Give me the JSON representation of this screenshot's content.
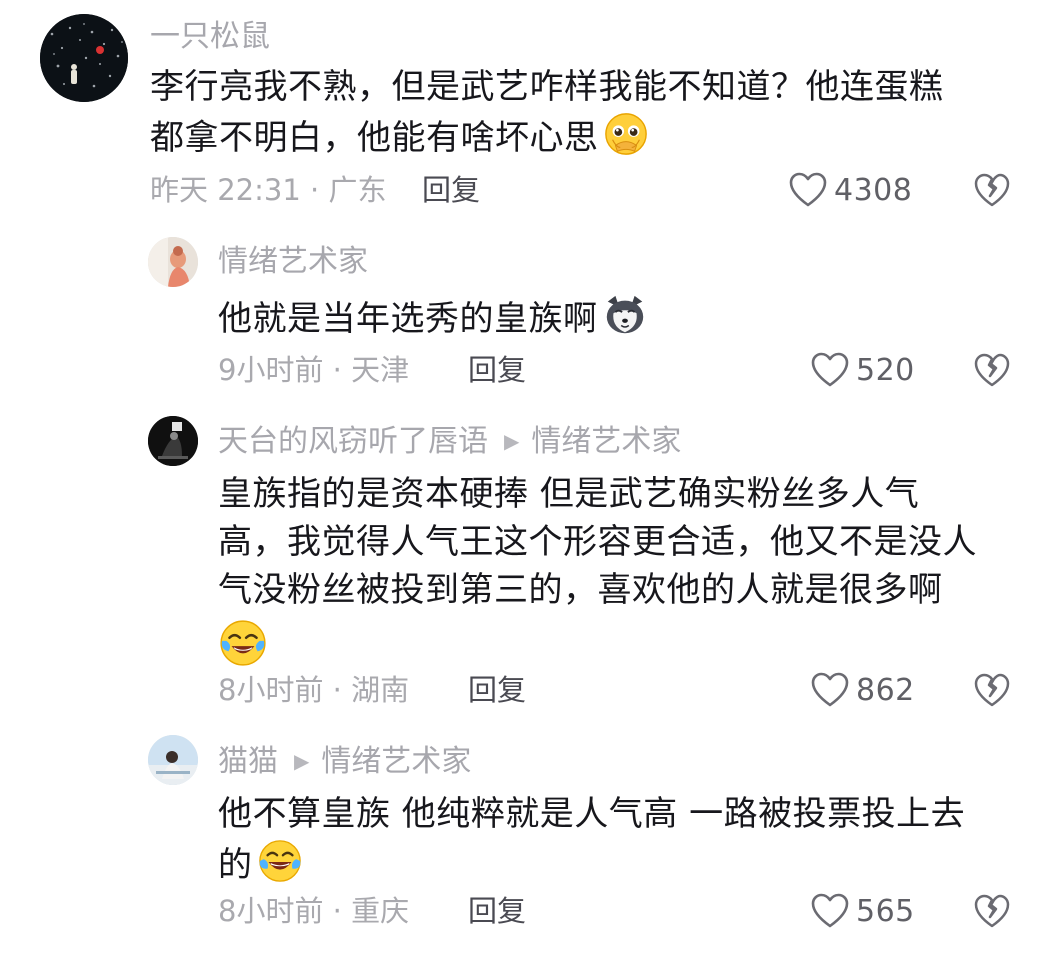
{
  "comments": [
    {
      "username": "一只松鼠",
      "text": "李行亮我不熟，但是武艺咋样我能不知道？他连蛋糕都拿不明白，他能有啥坏心思",
      "line1": "李行亮我不熟，但是武艺咋样我能不知道？他连蛋糕",
      "line2": "都拿不明白，他能有啥坏心思",
      "emoji": "pleading-face-icon",
      "meta": "昨天 22:31 · 广东",
      "reply": "回复",
      "likes": "4308"
    },
    {
      "username": "情绪艺术家",
      "line1": "他就是当年选秀的皇族啊",
      "emoji": "husky-dog-icon",
      "meta": "9小时前 · 天津",
      "reply": "回复",
      "likes": "520"
    },
    {
      "username": "天台的风窃听了唇语",
      "reply_to": "情绪艺术家",
      "line1": "皇族指的是资本硬捧 但是武艺确实粉丝多人气",
      "line2": "高，我觉得人气王这个形容更合适，他又不是没人",
      "line3": "气没粉丝被投到第三的，喜欢他的人就是很多啊",
      "emoji": "crying-laughing-icon",
      "meta": "8小时前 · 湖南",
      "reply": "回复",
      "likes": "862"
    },
    {
      "username": "猫猫",
      "reply_to": "情绪艺术家",
      "line1": "他不算皇族 他纯粹就是人气高 一路被投票投上去",
      "line2": "的",
      "emoji": "laughing-tears-icon",
      "meta": "8小时前 · 重庆",
      "reply": "回复",
      "likes": "565"
    }
  ],
  "colors": {
    "username": "#a7a7ad",
    "content": "#17171c",
    "meta": "#a9a9ae",
    "reply": "#4a4a52",
    "icon": "#6b6b72"
  }
}
